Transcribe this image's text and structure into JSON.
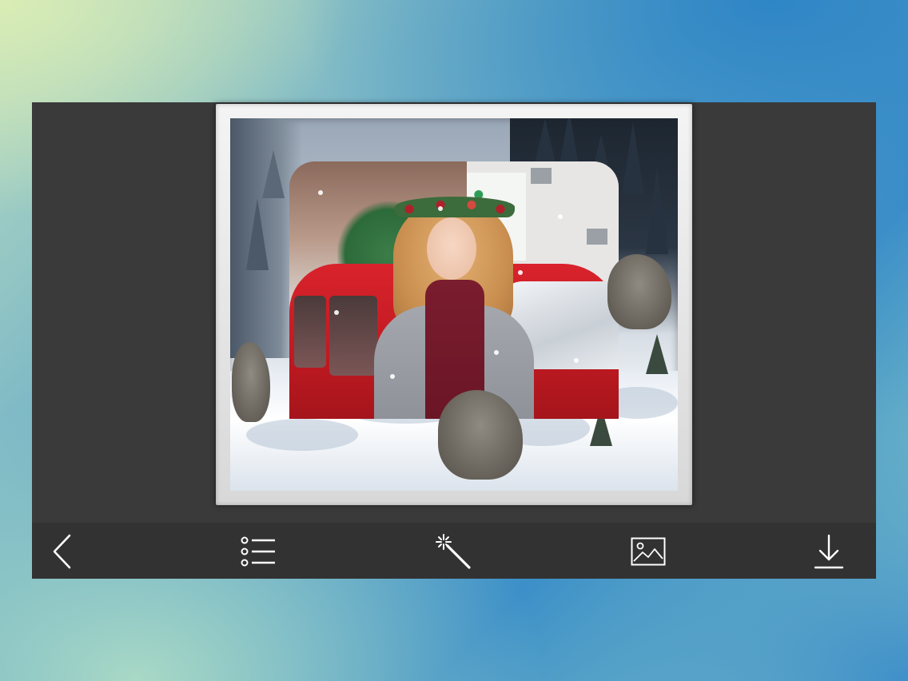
{
  "toolbar": {
    "items": [
      {
        "name": "back",
        "icon": "chevron-left-icon",
        "label": ""
      },
      {
        "name": "frames",
        "icon": "list-icon",
        "label": ""
      },
      {
        "name": "effects",
        "icon": "magic-wand-icon",
        "label": ""
      },
      {
        "name": "gallery",
        "icon": "image-icon",
        "label": ""
      },
      {
        "name": "download",
        "icon": "download-icon",
        "label": ""
      }
    ],
    "icon_color": "#ffffff",
    "background": "#323232"
  },
  "colors": {
    "canvas_background": "#3a3a3a",
    "frame_border": "#e6e6e6",
    "page_gradient_start": "#d9ecb4",
    "page_gradient_end": "#2f86c6"
  }
}
